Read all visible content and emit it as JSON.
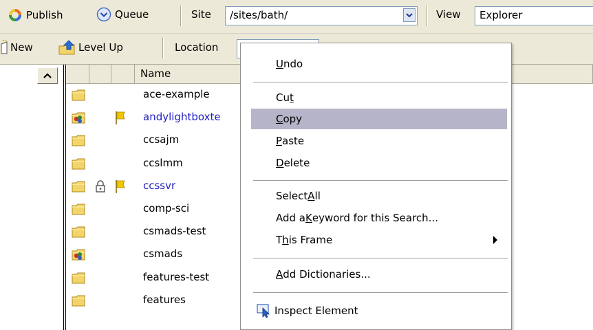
{
  "toolbar1": {
    "publish_label": "Publish",
    "queue_label": "Queue",
    "site_label": "Site",
    "site_value": "/sites/bath/",
    "view_label": "View",
    "view_value": "Explorer"
  },
  "toolbar2": {
    "new_label": "New",
    "levelup_label": "Level Up",
    "location_label": "Location",
    "location_value": "/"
  },
  "list": {
    "name_header": "Name",
    "rows": [
      {
        "name": "ace-example",
        "icon": "folder-icon",
        "locked": false,
        "flagged": false,
        "highlight": false
      },
      {
        "name": "andylightboxte",
        "icon": "shared-folder-icon",
        "locked": false,
        "flagged": true,
        "highlight": true
      },
      {
        "name": "ccsajm",
        "icon": "folder-icon",
        "locked": false,
        "flagged": false,
        "highlight": false
      },
      {
        "name": "ccslmm",
        "icon": "folder-icon",
        "locked": false,
        "flagged": false,
        "highlight": false
      },
      {
        "name": "ccssvr",
        "icon": "folder-icon",
        "locked": true,
        "flagged": true,
        "highlight": true
      },
      {
        "name": "comp-sci",
        "icon": "folder-icon",
        "locked": false,
        "flagged": false,
        "highlight": false
      },
      {
        "name": "csmads-test",
        "icon": "folder-icon",
        "locked": false,
        "flagged": false,
        "highlight": false
      },
      {
        "name": "csmads",
        "icon": "shared-folder-icon",
        "locked": false,
        "flagged": false,
        "highlight": false
      },
      {
        "name": "features-test",
        "icon": "folder-icon",
        "locked": false,
        "flagged": false,
        "highlight": false
      },
      {
        "name": "features",
        "icon": "folder-icon",
        "locked": false,
        "flagged": false,
        "highlight": false
      }
    ]
  },
  "menu": {
    "undo": {
      "pre": "",
      "key": "U",
      "post": "ndo"
    },
    "cut": {
      "pre": "Cu",
      "key": "t",
      "post": ""
    },
    "copy": {
      "pre": "",
      "key": "C",
      "post": "opy"
    },
    "paste": {
      "pre": "",
      "key": "P",
      "post": "aste"
    },
    "delete": {
      "pre": "",
      "key": "D",
      "post": "elete"
    },
    "select_all": {
      "pre": "Select ",
      "key": "A",
      "post": "ll"
    },
    "add_keyword": {
      "pre": "Add a ",
      "key": "K",
      "post": "eyword for this Search..."
    },
    "this_frame": {
      "pre": "T",
      "key": "h",
      "post": "is Frame"
    },
    "add_dictionaries": {
      "pre": "",
      "key": "A",
      "post": "dd Dictionaries..."
    },
    "inspect_element": "Inspect Element"
  },
  "colors": {
    "toolbar_bg": "#ece9d8",
    "menu_highlight": "#b6b4c8",
    "link_blue": "#2020c0",
    "folder_yellow": "#f2d46a",
    "flag_yellow": "#f0c800"
  }
}
